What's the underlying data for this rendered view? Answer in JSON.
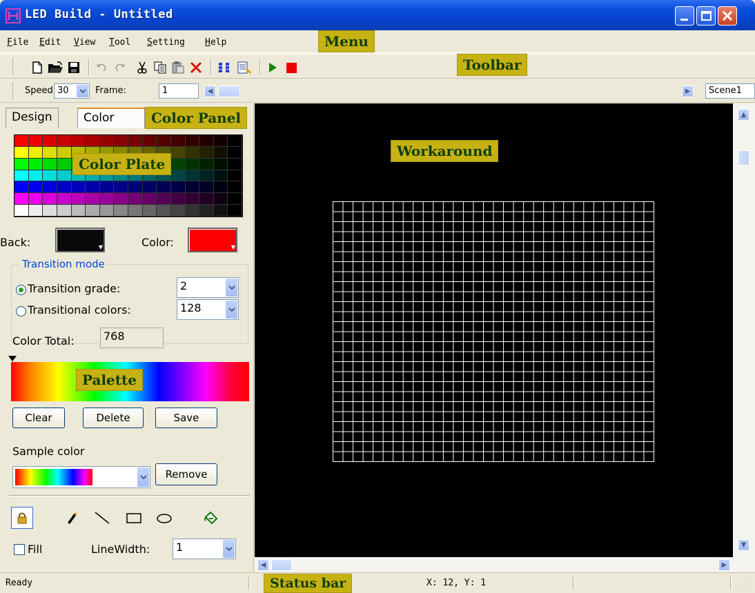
{
  "window": {
    "title": "LED Build - Untitled"
  },
  "menu": {
    "items": [
      "File",
      "Edit",
      "View",
      "Tool",
      "Setting",
      "Help"
    ]
  },
  "toolbar": {
    "icons": [
      "new-file-icon",
      "open-folder-icon",
      "save-icon",
      "undo-icon",
      "redo-icon",
      "cut-icon",
      "copy-icon",
      "paste-icon",
      "delete-icon",
      "grid-icon",
      "edit-list-icon",
      "play-icon",
      "stop-icon"
    ]
  },
  "speedbar": {
    "speed_label": "Speed:",
    "speed_value": "30",
    "frame_label": "Frame:",
    "frame_value": "1",
    "scene_value": "Scene1"
  },
  "tabs": {
    "design": "Design",
    "color": "Color"
  },
  "color_plate": {
    "rows": [
      [
        "#ff0000",
        "#ee0000",
        "#dd0000",
        "#cc0000",
        "#bb0000",
        "#aa0000",
        "#990000",
        "#880000",
        "#770000",
        "#660000",
        "#550000",
        "#440000",
        "#330000",
        "#220000",
        "#110000",
        "#000000"
      ],
      [
        "#ffff00",
        "#eeee00",
        "#dddd00",
        "#cccc00",
        "#bbbb00",
        "#aaaa00",
        "#999900",
        "#888800",
        "#777700",
        "#666600",
        "#555500",
        "#444400",
        "#333300",
        "#222200",
        "#111100",
        "#000000"
      ],
      [
        "#00ff00",
        "#00ee00",
        "#00dd00",
        "#00cc00",
        "#00bb00",
        "#00aa00",
        "#009900",
        "#008800",
        "#007700",
        "#006600",
        "#005500",
        "#004400",
        "#003300",
        "#002200",
        "#001100",
        "#000000"
      ],
      [
        "#00ffff",
        "#00eeee",
        "#00dddd",
        "#00cccc",
        "#00bbbb",
        "#00aaaa",
        "#009999",
        "#008888",
        "#007777",
        "#006666",
        "#005555",
        "#004444",
        "#003333",
        "#002222",
        "#001111",
        "#000000"
      ],
      [
        "#0000ff",
        "#0000ee",
        "#0000dd",
        "#0000cc",
        "#0000bb",
        "#0000aa",
        "#000099",
        "#000088",
        "#000077",
        "#000066",
        "#000055",
        "#000044",
        "#000033",
        "#000022",
        "#000011",
        "#000000"
      ],
      [
        "#ff00ff",
        "#ee00ee",
        "#dd00dd",
        "#cc00cc",
        "#bb00bb",
        "#aa00aa",
        "#990099",
        "#880088",
        "#770077",
        "#660066",
        "#550055",
        "#440044",
        "#330033",
        "#220022",
        "#110011",
        "#000000"
      ],
      [
        "#ffffff",
        "#eeeeee",
        "#dddddd",
        "#cccccc",
        "#bbbbbb",
        "#aaaaaa",
        "#999999",
        "#888888",
        "#777777",
        "#666666",
        "#555555",
        "#444444",
        "#333333",
        "#222222",
        "#111111",
        "#000000"
      ]
    ]
  },
  "color_panel": {
    "back_label": "Back:",
    "back_color": "#0a0a0a",
    "color_label": "Color:",
    "fore_color": "#ff0000",
    "transition_legend": "Transition mode",
    "grade_label": "Transition grade:",
    "grade_value": "2",
    "colors_label": "Transitional colors:",
    "colors_value": "128",
    "total_label": "Color Total:",
    "total_value": "768",
    "clear_label": "Clear",
    "delete_label": "Delete",
    "save_label": "Save",
    "sample_label": "Sample color",
    "remove_label": "Remove",
    "fill_label": "Fill",
    "linewidth_label": "LineWidth:",
    "linewidth_value": "1"
  },
  "workarea": {
    "grid_cols": 32,
    "grid_rows": 26
  },
  "status": {
    "ready": "Ready",
    "coords": "X: 12, Y: 1"
  },
  "annotations": {
    "menu": "Menu",
    "toolbar": "Toolbar",
    "color_panel": "Color Panel",
    "color_plate": "Color Plate",
    "workaround": "Workaround",
    "palette": "Palette",
    "status_bar": "Status bar"
  }
}
